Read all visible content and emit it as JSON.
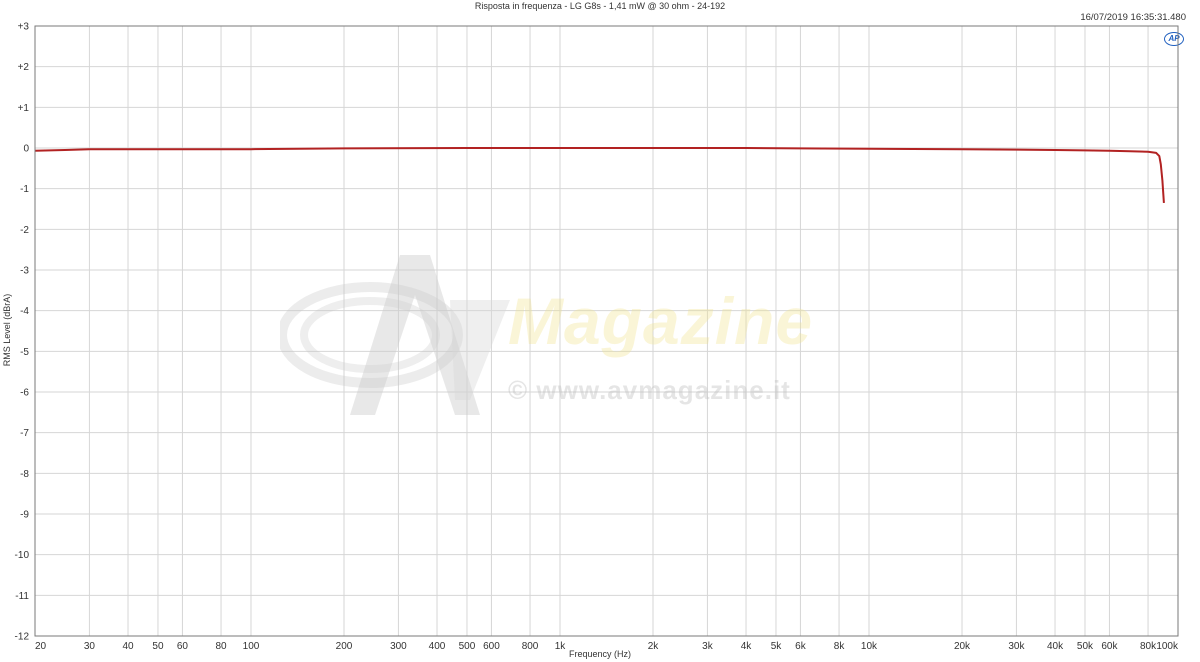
{
  "chart_data": {
    "type": "line",
    "title": "Risposta in frequenza - LG G8s - 1,41 mW @ 30 ohm - 24-192",
    "timestamp": "16/07/2019 16:35:31.480",
    "xlabel": "Frequency (Hz)",
    "ylabel": "RMS Level (dBrA)",
    "xscale": "log",
    "xlim": [
      20,
      100000
    ],
    "ylim": [
      -12,
      3
    ],
    "grid": true,
    "x_ticks": [
      {
        "value": 20,
        "label": "20"
      },
      {
        "value": 30,
        "label": "30"
      },
      {
        "value": 40,
        "label": "40"
      },
      {
        "value": 50,
        "label": "50"
      },
      {
        "value": 60,
        "label": "60"
      },
      {
        "value": 80,
        "label": "80"
      },
      {
        "value": 100,
        "label": "100"
      },
      {
        "value": 200,
        "label": "200"
      },
      {
        "value": 300,
        "label": "300"
      },
      {
        "value": 400,
        "label": "400"
      },
      {
        "value": 500,
        "label": "500"
      },
      {
        "value": 600,
        "label": "600"
      },
      {
        "value": 800,
        "label": "800"
      },
      {
        "value": 1000,
        "label": "1k"
      },
      {
        "value": 2000,
        "label": "2k"
      },
      {
        "value": 3000,
        "label": "3k"
      },
      {
        "value": 4000,
        "label": "4k"
      },
      {
        "value": 5000,
        "label": "5k"
      },
      {
        "value": 6000,
        "label": "6k"
      },
      {
        "value": 8000,
        "label": "8k"
      },
      {
        "value": 10000,
        "label": "10k"
      },
      {
        "value": 20000,
        "label": "20k"
      },
      {
        "value": 30000,
        "label": "30k"
      },
      {
        "value": 40000,
        "label": "40k"
      },
      {
        "value": 50000,
        "label": "50k"
      },
      {
        "value": 60000,
        "label": "60k"
      },
      {
        "value": 80000,
        "label": "80k"
      },
      {
        "value": 100000,
        "label": "100k"
      }
    ],
    "y_ticks": [
      {
        "value": 3,
        "label": "+3"
      },
      {
        "value": 2,
        "label": "+2"
      },
      {
        "value": 1,
        "label": "+1"
      },
      {
        "value": 0,
        "label": "0"
      },
      {
        "value": -1,
        "label": "-1"
      },
      {
        "value": -2,
        "label": "-2"
      },
      {
        "value": -3,
        "label": "-3"
      },
      {
        "value": -4,
        "label": "-4"
      },
      {
        "value": -5,
        "label": "-5"
      },
      {
        "value": -6,
        "label": "-6"
      },
      {
        "value": -7,
        "label": "-7"
      },
      {
        "value": -8,
        "label": "-8"
      },
      {
        "value": -9,
        "label": "-9"
      },
      {
        "value": -10,
        "label": "-10"
      },
      {
        "value": -11,
        "label": "-11"
      },
      {
        "value": -12,
        "label": "-12"
      }
    ],
    "series": [
      {
        "color": "#b22222",
        "x": [
          20,
          25,
          30,
          40,
          60,
          100,
          200,
          500,
          1000,
          2000,
          4000,
          6000,
          10000,
          20000,
          30000,
          40000,
          50000,
          60000,
          70000,
          80000,
          85000,
          87000,
          88000,
          89000,
          90000
        ],
        "y": [
          -0.07,
          -0.05,
          -0.03,
          -0.03,
          -0.03,
          -0.03,
          -0.01,
          0.0,
          0.0,
          0.0,
          0.0,
          -0.01,
          -0.02,
          -0.03,
          -0.04,
          -0.05,
          -0.06,
          -0.07,
          -0.08,
          -0.09,
          -0.12,
          -0.2,
          -0.4,
          -0.8,
          -1.35
        ]
      }
    ]
  },
  "watermark": {
    "brand": "Magazine",
    "url": "© www.avmagazine.it"
  },
  "logo": "AP",
  "colors": {
    "grid": "#d6d6d6",
    "axis": "#7a7a7a",
    "line": "#b22222"
  }
}
